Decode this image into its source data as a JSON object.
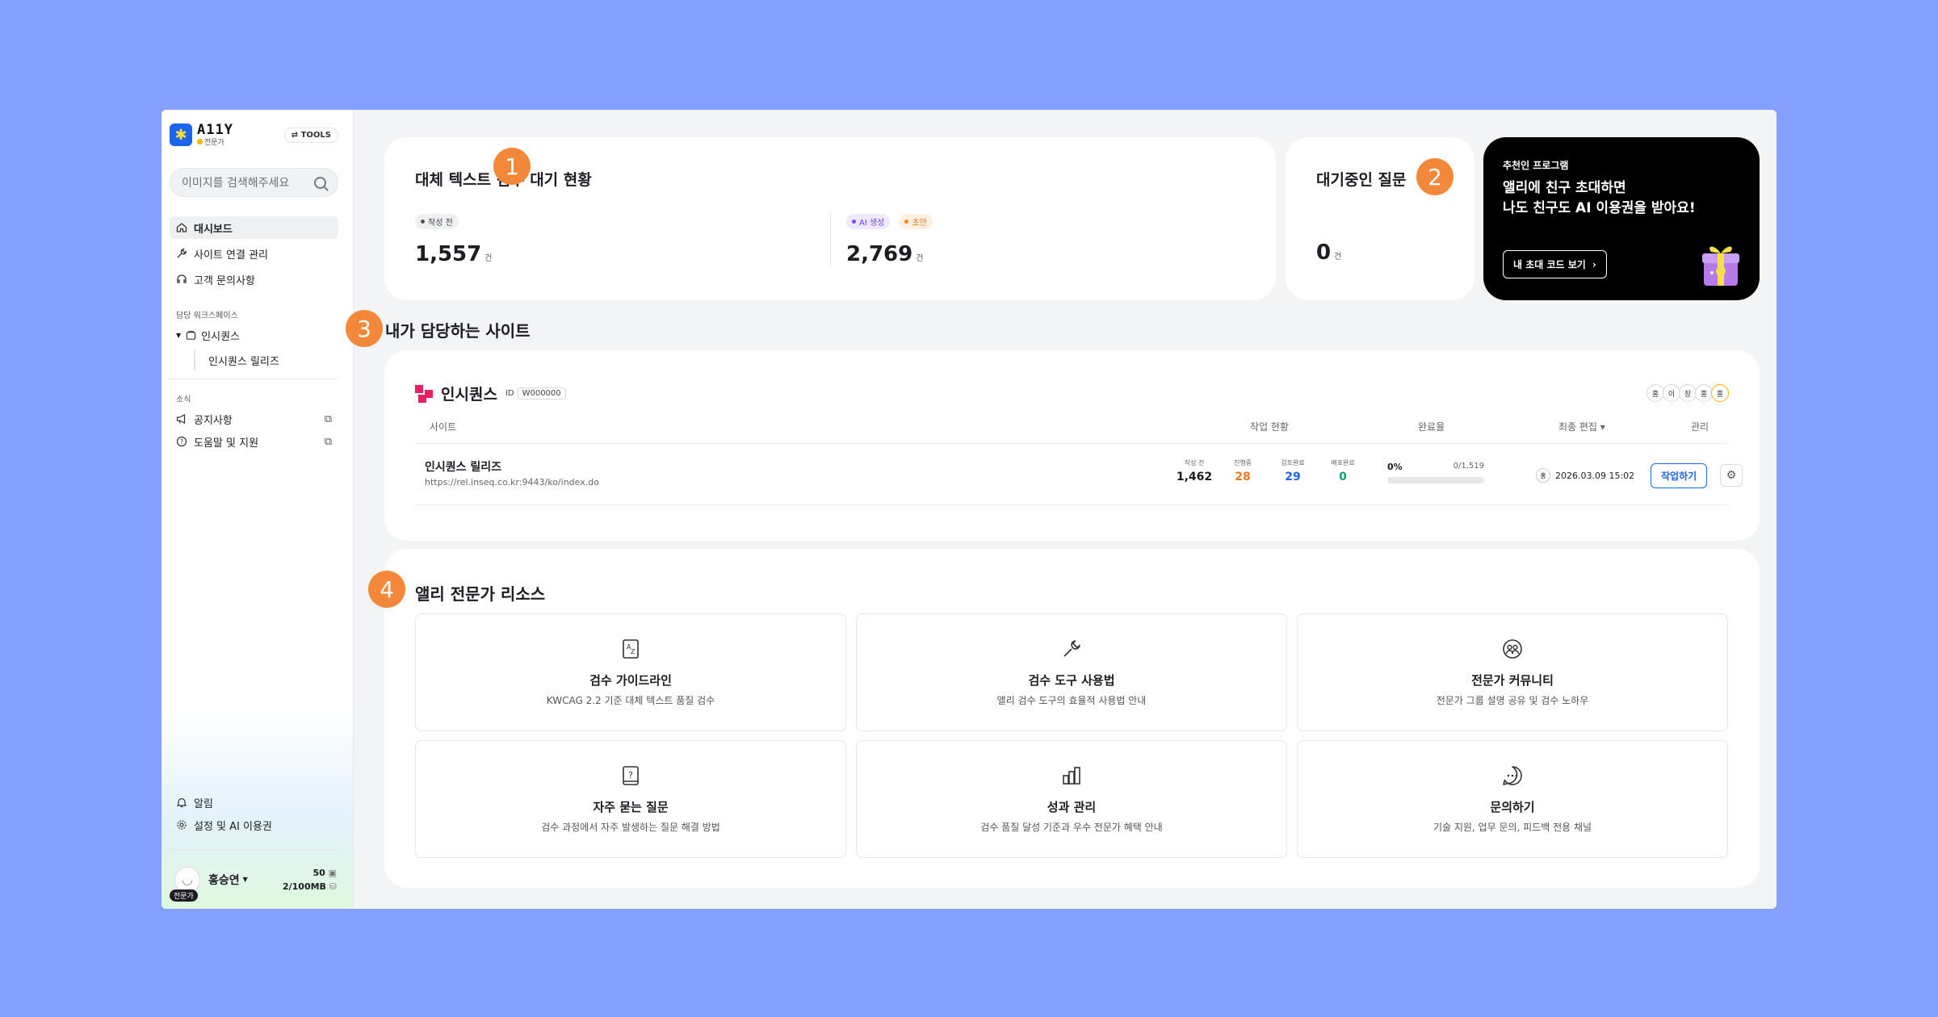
{
  "sidebar": {
    "logo_word": "A11Y",
    "logo_sub": "전문가",
    "tools_label": "⇄ TOOLS",
    "search_placeholder": "이미지를 검색해주세요",
    "nav": [
      {
        "label": "대시보드",
        "icon": "home-icon"
      },
      {
        "label": "사이트 연결 관리",
        "icon": "wrench-icon"
      },
      {
        "label": "고객 문의사항",
        "icon": "headset-icon"
      }
    ],
    "workspace_title": "담당 워크스페이스",
    "workspace_name": "인시퀀스",
    "workspace_site": "인시퀀스 릴리즈",
    "news_title": "소식",
    "news": [
      {
        "label": "공지사항",
        "icon": "megaphone-icon"
      },
      {
        "label": "도움말 및 지원",
        "icon": "help-icon"
      }
    ],
    "bottom": [
      {
        "label": "알림",
        "icon": "bell-icon"
      },
      {
        "label": "설정 및 AI 이용권",
        "icon": "gear-icon"
      }
    ],
    "user": {
      "name": "홍승연",
      "badge": "전문가",
      "count": "50",
      "storage": "2/100MB"
    }
  },
  "summary": {
    "title": "대체 텍스트 검수 대기 현황",
    "left_pill": "작성 전",
    "left_value": "1,557",
    "unit": "건",
    "right_pill_ai": "AI 생성",
    "right_pill_draft": "초안",
    "right_value": "2,769"
  },
  "questions": {
    "title": "대기중인 질문",
    "value": "0",
    "unit": "건"
  },
  "promo": {
    "label": "추천인 프로그램",
    "line1": "앨리에 친구 초대하면",
    "line2": "나도 친구도 AI 이용권을 받아요!",
    "button": "내 초대 코드 보기"
  },
  "badges": [
    "1",
    "2",
    "3",
    "4"
  ],
  "my_sites": {
    "heading": "내가 담당하는 사이트",
    "workspace": "인시퀀스",
    "id_label": "ID",
    "id_value": "W000000",
    "members": [
      "홍",
      "이",
      "장",
      "홍",
      "홍"
    ],
    "columns": {
      "site": "사이트",
      "status": "작업 현황",
      "rate": "완료율",
      "edited": "최종 편집 ▾",
      "manage": "관리"
    },
    "row": {
      "name": "인시퀀스 릴리즈",
      "url": "https://rel.inseq.co.kr:9443/ko/index.do",
      "stats": [
        {
          "label": "작성 전",
          "value": "1,462",
          "color": "#1b1d22"
        },
        {
          "label": "진행중",
          "value": "28",
          "color": "#f0781e"
        },
        {
          "label": "검토완료",
          "value": "29",
          "color": "#1c64f2"
        },
        {
          "label": "배포완료",
          "value": "0",
          "color": "#14a36a"
        }
      ],
      "percent": "0%",
      "progress_text": "0/1,519",
      "progress_fraction": 0,
      "editor": "홍",
      "edited_at": "2026.03.09 15:02",
      "work_button": "작업하기"
    }
  },
  "resources": {
    "heading": "앨리 전문가 리소스",
    "items": [
      {
        "title": "검수 가이드라인",
        "desc": "KWCAG 2.2 기준 대체 텍스트 품질 검수",
        "icon": "dictionary-icon"
      },
      {
        "title": "검수 도구 사용법",
        "desc": "앨리 검수 도구의 효율적 사용법 안내",
        "icon": "wrench-icon"
      },
      {
        "title": "전문가 커뮤니티",
        "desc": "전문가 그룹 설명 공유 및 검수 노하우",
        "icon": "community-icon"
      },
      {
        "title": "자주 묻는 질문",
        "desc": "검수 과정에서 자주 발생하는 질문 해결 방법",
        "icon": "question-book-icon"
      },
      {
        "title": "성과 관리",
        "desc": "검수 품질 달성 기준과 우수 전문가 혜택 안내",
        "icon": "bar-chart-icon"
      },
      {
        "title": "문의하기",
        "desc": "기술 지원, 업무 문의, 피드백 전용 채널",
        "icon": "chat-icon"
      }
    ]
  },
  "colors": {
    "background": "#859ffc",
    "accent": "#1c64f2",
    "badge": "#f4883a"
  }
}
